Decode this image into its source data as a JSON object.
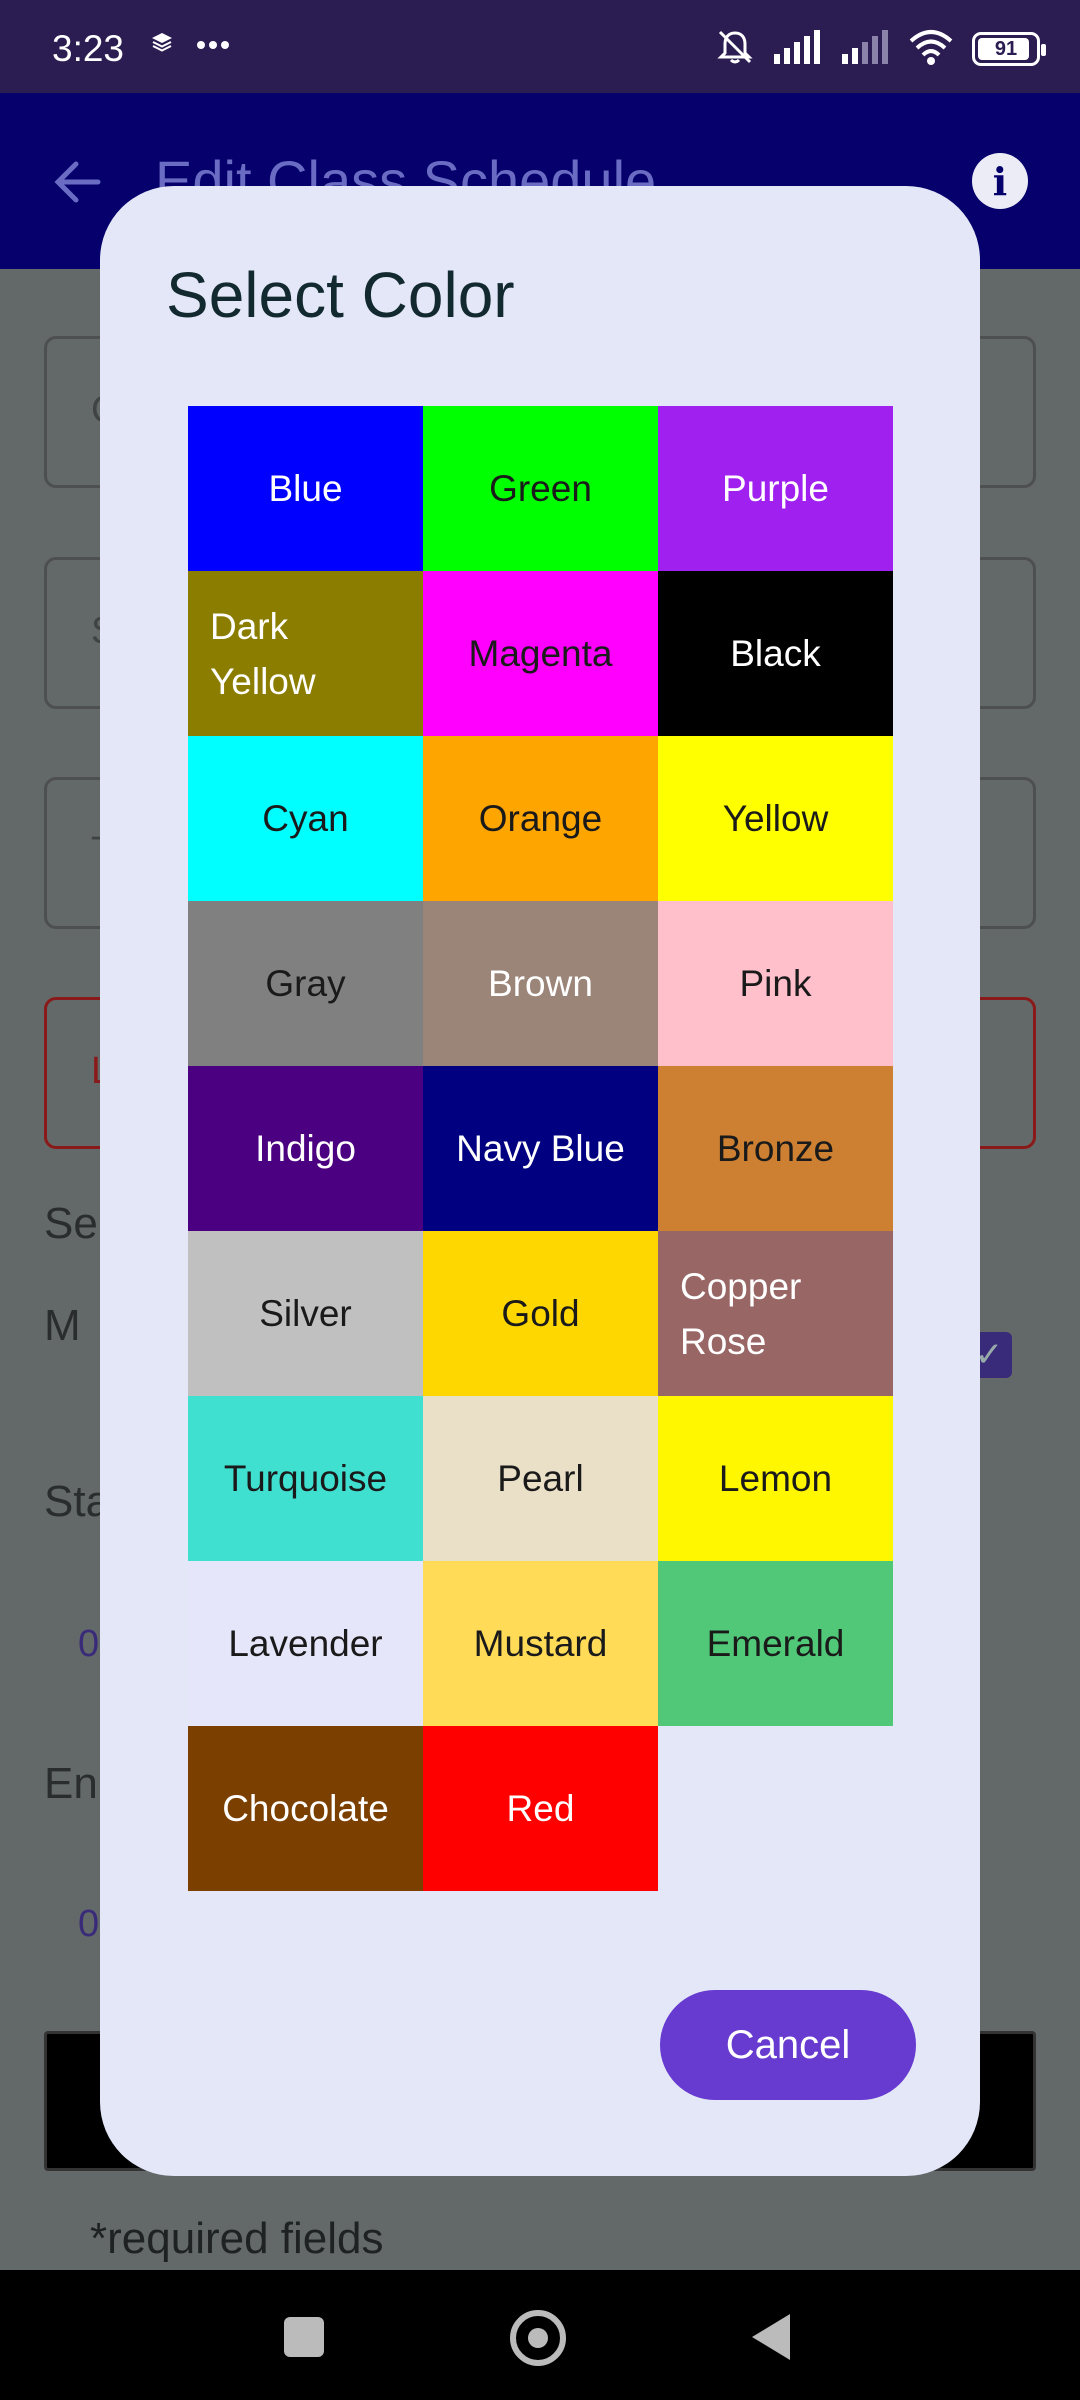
{
  "status_bar": {
    "time": "3:23",
    "battery": "91",
    "battery_level": 0.91,
    "icons": [
      "layers-icon",
      "more-dots-icon",
      "bell-off-icon",
      "signal-icon",
      "signal-weak-icon",
      "wifi-icon",
      "battery-icon"
    ]
  },
  "app_bar": {
    "title": "Edit Class Schedule",
    "back_icon": "arrow-back-icon",
    "info_icon": "info-icon"
  },
  "background_form": {
    "field_1_initial": "C",
    "field_2_initial": "S",
    "field_3_initial": "T",
    "field_4_initial": "L",
    "section_label": "Se",
    "day_label": "M",
    "start_label": "Sta",
    "start_value": "0",
    "end_label": "En",
    "end_value": "0",
    "required_note": "*required fields"
  },
  "dialog": {
    "title": "Select Color",
    "cancel_label": "Cancel",
    "colors": [
      {
        "name": "Blue",
        "hex": "#0000ff",
        "text_color": "#ffffff"
      },
      {
        "name": "Green",
        "hex": "#00ff00",
        "text_color": "#1a1a1a"
      },
      {
        "name": "Purple",
        "hex": "#a020f0",
        "text_color": "#ffffff"
      },
      {
        "name": "Dark Yellow",
        "hex": "#8b7d00",
        "text_color": "#ffffff"
      },
      {
        "name": "Magenta",
        "hex": "#ff00ff",
        "text_color": "#1a1a1a"
      },
      {
        "name": "Black",
        "hex": "#000000",
        "text_color": "#ffffff"
      },
      {
        "name": "Cyan",
        "hex": "#00ffff",
        "text_color": "#1a1a1a"
      },
      {
        "name": "Orange",
        "hex": "#ffa500",
        "text_color": "#1a1a1a"
      },
      {
        "name": "Yellow",
        "hex": "#ffff00",
        "text_color": "#1a1a1a"
      },
      {
        "name": "Gray",
        "hex": "#808080",
        "text_color": "#1a1a1a"
      },
      {
        "name": "Brown",
        "hex": "#9b8478",
        "text_color": "#ffffff"
      },
      {
        "name": "Pink",
        "hex": "#ffc0cb",
        "text_color": "#1a1a1a"
      },
      {
        "name": "Indigo",
        "hex": "#4b0082",
        "text_color": "#ffffff"
      },
      {
        "name": "Navy Blue",
        "hex": "#000080",
        "text_color": "#ffffff"
      },
      {
        "name": "Bronze",
        "hex": "#cd7f32",
        "text_color": "#1a1a1a"
      },
      {
        "name": "Silver",
        "hex": "#c0c0c0",
        "text_color": "#1a1a1a"
      },
      {
        "name": "Gold",
        "hex": "#ffd700",
        "text_color": "#1a1a1a"
      },
      {
        "name": "Copper Rose",
        "hex": "#996666",
        "text_color": "#ffffff"
      },
      {
        "name": "Turquoise",
        "hex": "#40e0d0",
        "text_color": "#1a1a1a"
      },
      {
        "name": "Pearl",
        "hex": "#eae0c8",
        "text_color": "#1a1a1a"
      },
      {
        "name": "Lemon",
        "hex": "#fff700",
        "text_color": "#1a1a1a"
      },
      {
        "name": "Lavender",
        "hex": "#e6e6fa",
        "text_color": "#1a1a1a"
      },
      {
        "name": "Mustard",
        "hex": "#ffdb58",
        "text_color": "#1a1a1a"
      },
      {
        "name": "Emerald",
        "hex": "#50c878",
        "text_color": "#1a1a1a"
      },
      {
        "name": "Chocolate",
        "hex": "#7b3f00",
        "text_color": "#ffffff"
      },
      {
        "name": "Red",
        "hex": "#ff0000",
        "text_color": "#ffffff"
      }
    ]
  },
  "nav_bar": {
    "icons": [
      "recents-square-icon",
      "home-circle-icon",
      "back-triangle-icon"
    ]
  }
}
